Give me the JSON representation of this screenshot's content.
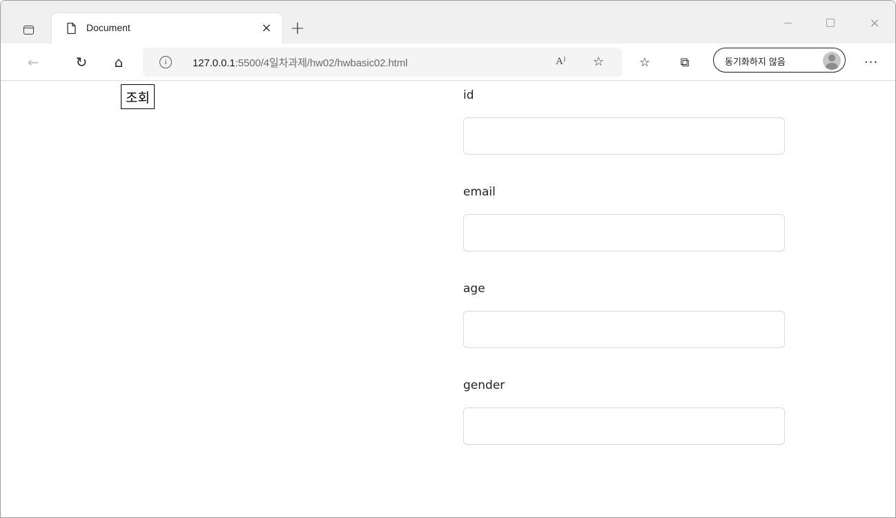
{
  "browser": {
    "tab": {
      "title": "Document",
      "close": "×"
    },
    "new_tab": "+",
    "window_controls": {
      "close": "×"
    },
    "toolbar": {
      "url_host": "127.0.0.1",
      "url_rest": ":5500/4일차과제/hw02/hwbasic02.html",
      "profile_label": "동기화하지 않음",
      "back_icon": "←",
      "reload_icon": "↻",
      "home_icon": "⌂",
      "read_aloud_icon": "A⁾",
      "add_favorite_icon": "☆",
      "favorites_icon": "☆",
      "collections_icon": "⧉",
      "more_icon": "···"
    }
  },
  "page": {
    "query_button": "조회",
    "fields": [
      {
        "label": "id",
        "value": ""
      },
      {
        "label": "email",
        "value": ""
      },
      {
        "label": "age",
        "value": ""
      },
      {
        "label": "gender",
        "value": ""
      }
    ]
  }
}
